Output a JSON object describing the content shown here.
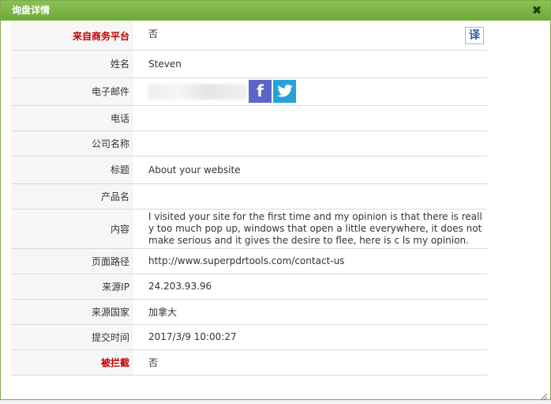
{
  "dialog": {
    "title": "询盘详情",
    "close_symbol": "✖"
  },
  "translate_label": "译",
  "rows": {
    "from_business_platform": {
      "label": "来自商务平台",
      "value": "否"
    },
    "name": {
      "label": "姓名",
      "value": "Steven"
    },
    "email": {
      "label": "电子邮件",
      "value": ""
    },
    "phone": {
      "label": "电话",
      "value": ""
    },
    "company": {
      "label": "公司名称",
      "value": ""
    },
    "subject": {
      "label": "标题",
      "value": "About your website"
    },
    "product": {
      "label": "产品名",
      "value": ""
    },
    "content": {
      "label": "内容",
      "value": "I visited your site for the first time and my opinion is that there is really too much pop up, windows that open a little everywhere, it does not make serious and it gives the desire to flee, here is c ls my opinion."
    },
    "page_path": {
      "label": "页面路径",
      "value": "http://www.superpdrtools.com/contact-us"
    },
    "source_ip": {
      "label": "来源IP",
      "value": "24.203.93.96"
    },
    "source_country": {
      "label": "来源国家",
      "value": "加拿大"
    },
    "submit_time": {
      "label": "提交时间",
      "value": "2017/3/9 10:00:27"
    },
    "blocked": {
      "label": "被拦截",
      "value": "否"
    }
  },
  "social": {
    "facebook_glyph": "f",
    "twitter_glyph": "🐦"
  }
}
